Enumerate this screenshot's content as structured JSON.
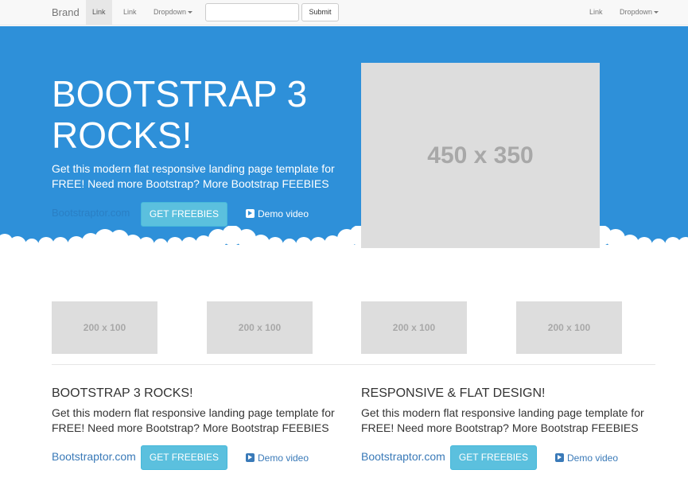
{
  "navbar": {
    "brand": "Brand",
    "links_left": [
      {
        "label": "Link",
        "active": true
      },
      {
        "label": "Link",
        "active": false
      },
      {
        "label": "Dropdown",
        "active": false
      }
    ],
    "search": {
      "value": "",
      "placeholder": ""
    },
    "submit_label": "Submit",
    "links_right": [
      {
        "label": "Link"
      },
      {
        "label": "Dropdown"
      }
    ]
  },
  "hero": {
    "title_line1": "BOOTSTRAP 3",
    "title_line2": "ROCKS!",
    "subtitle": "Get this modern flat responsive landing page template for FREE! Need more Bootstrap? More Bootstrap FEEBIES",
    "brand_link": "Bootstraptor.com",
    "button_label": "GET FREEBIES",
    "demo_label": "Demo video",
    "image_label": "450 x 350"
  },
  "thumbnails": [
    {
      "label": "200 x 100"
    },
    {
      "label": "200 x 100"
    },
    {
      "label": "200 x 100"
    },
    {
      "label": "200 x 100"
    }
  ],
  "columns": [
    {
      "title": "BOOTSTRAP 3 ROCKS!",
      "text": "Get this modern flat responsive landing page template for FREE! Need more Bootstrap? More Bootstrap FEEBIES",
      "link": "Bootstraptor.com",
      "button_label": "GET FREEBIES",
      "demo_label": "Demo video"
    },
    {
      "title": "RESPONSIVE & FLAT DESIGN!",
      "text": "Get this modern flat responsive landing page template for FREE! Need more Bootstrap? More Bootstrap FEEBIES",
      "link": "Bootstraptor.com",
      "button_label": "GET FREEBIES",
      "demo_label": "Demo video"
    }
  ],
  "colors": {
    "hero_bg": "#2e90d9",
    "button_bg": "#5bc0de",
    "link": "#3a7ab8",
    "placeholder_bg": "#dddddd",
    "navbar_bg": "#f8f8f8"
  },
  "icons": [
    "play-icon",
    "caret-down-icon",
    "clouds-divider"
  ]
}
